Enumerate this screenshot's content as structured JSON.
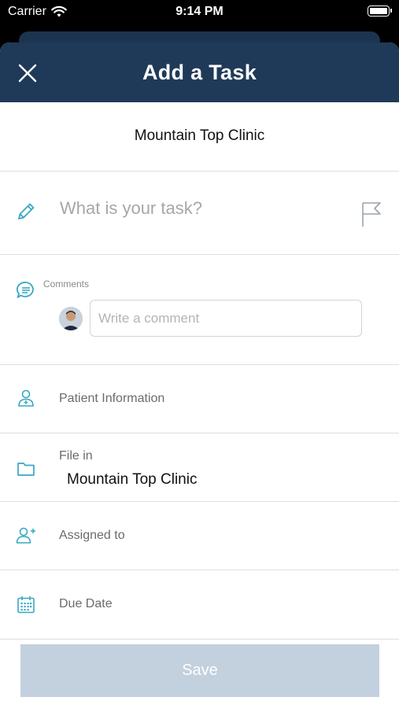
{
  "status_bar": {
    "carrier": "Carrier",
    "time": "9:14 PM"
  },
  "header": {
    "title": "Add a Task"
  },
  "clinic": {
    "name": "Mountain Top Clinic"
  },
  "task": {
    "placeholder": "What is your task?"
  },
  "comments": {
    "label": "Comments",
    "placeholder": "Write a comment"
  },
  "patient": {
    "label": "Patient Information"
  },
  "file_in": {
    "label": "File in",
    "value": "Mountain Top Clinic"
  },
  "assigned": {
    "label": "Assigned to"
  },
  "due_date": {
    "label": "Due Date"
  },
  "save_button": {
    "label": "Save"
  },
  "colors": {
    "header_bg": "#1f3a58",
    "accent_icon": "#38a8c4",
    "save_disabled": "#c3d0de"
  }
}
